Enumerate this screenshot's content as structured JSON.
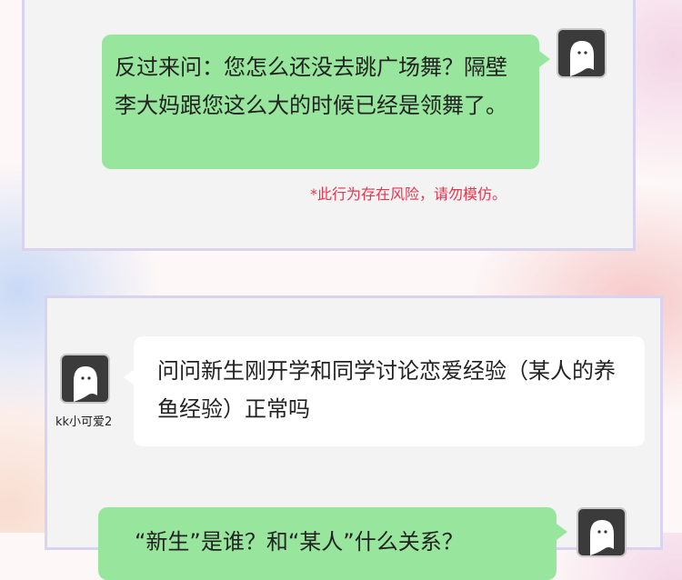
{
  "messages": [
    {
      "side": "right",
      "text": "反过来问：您怎么还没去跳广场舞？隔壁李大妈跟您这么大的时候已经是领舞了。"
    },
    {
      "side": "left",
      "username": "kk小可爱2",
      "text": "问问新生刚开学和同学讨论恋爱经验（某人的养鱼经验）正常吗"
    },
    {
      "side": "right",
      "text": "“新生”是谁？和“某人”什么关系？"
    }
  ],
  "warning_note": "*此行为存在风险，请勿模仿。",
  "colors": {
    "green_bubble": "#98e69e",
    "white_bubble": "#ffffff",
    "warning": "#e8344c",
    "card_border": "#d9d3ef",
    "card_bg": "#f3f3f3"
  },
  "icons": {
    "avatar": "ghost-avatar-icon"
  }
}
